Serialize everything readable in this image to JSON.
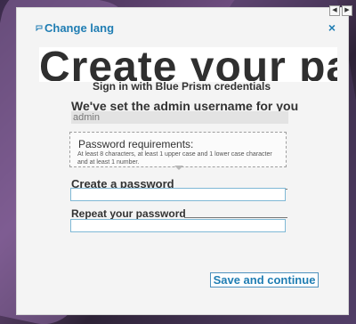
{
  "header": {
    "change_lang": "Change lang",
    "close": "×",
    "nav_left": "◀",
    "nav_right": "▶"
  },
  "hero": {
    "title": "Create your passw"
  },
  "subtitle": "Sign in with Blue Prism credentials",
  "username": {
    "label": "We've set the admin username for you",
    "value": "admin"
  },
  "requirements": {
    "title": "Password requirements:",
    "text": "At least 8 characters, at least 1 upper case and 1 lower case character and at least 1 number."
  },
  "fields": {
    "create_label": "Create a password",
    "repeat_label": "Repeat your password"
  },
  "actions": {
    "save_continue": "Save and continue"
  },
  "colors": {
    "accent": "#1f7db3",
    "input_border": "#7fb8d5"
  },
  "icons": {
    "chat": "chat-bubble-icon",
    "close": "close-icon"
  }
}
